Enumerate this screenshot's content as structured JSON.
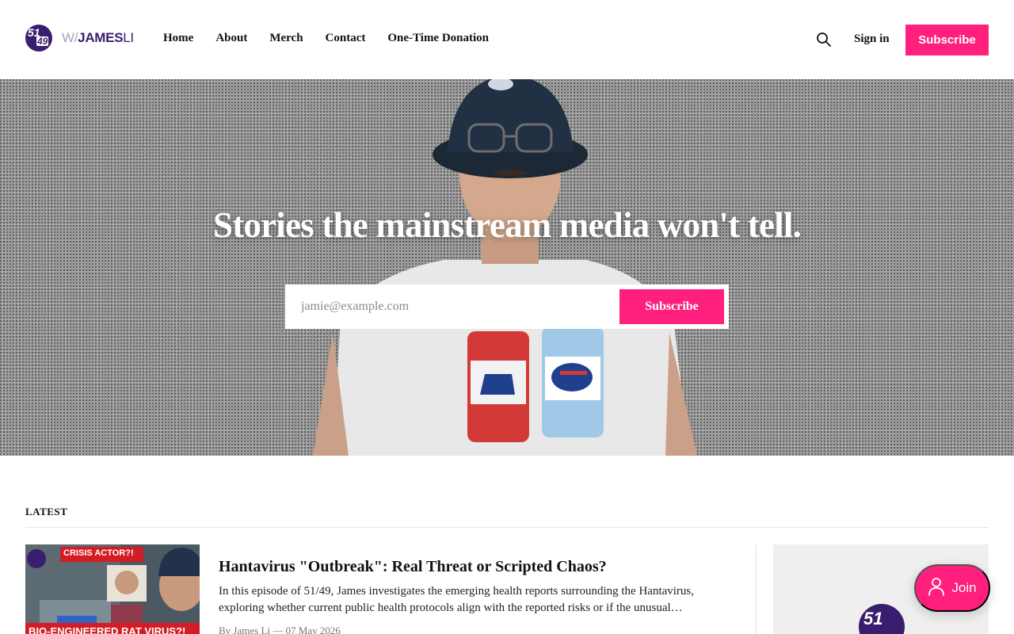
{
  "header": {
    "logo": {
      "badge_top": "51",
      "badge_bottom": "49",
      "prefix": "W/",
      "name_bold": "JAMES",
      "name_light": "LI"
    },
    "nav": [
      {
        "label": "Home"
      },
      {
        "label": "About"
      },
      {
        "label": "Merch"
      },
      {
        "label": "Contact"
      },
      {
        "label": "One-Time Donation"
      }
    ],
    "search_icon": "search-icon",
    "signin_label": "Sign in",
    "subscribe_label": "Subscribe"
  },
  "hero": {
    "title": "Stories the mainstream media won't tell.",
    "email_placeholder": "jamie@example.com",
    "subscribe_label": "Subscribe"
  },
  "latest": {
    "label": "LATEST",
    "posts": [
      {
        "title": "Hantavirus \"Outbreak\": Real Threat or Scripted Chaos?",
        "excerpt": "In this episode of 51/49, James investigates the emerging health reports surrounding the Hantavirus, exploring whether current public health protocols align with the reported risks or if the unusual…",
        "meta": "By James Li — 07 May 2026",
        "thumb_caption_top": "CRISIS ACTOR?!",
        "thumb_caption_bottom": "BIO-ENGINEERED RAT VIRUS?!"
      }
    ]
  },
  "side_card": {
    "logo_text": "51"
  },
  "join_button": {
    "label": "Join",
    "icon": "person-icon"
  },
  "colors": {
    "accent": "#ff1f7c",
    "brand": "#3a1d6e"
  }
}
